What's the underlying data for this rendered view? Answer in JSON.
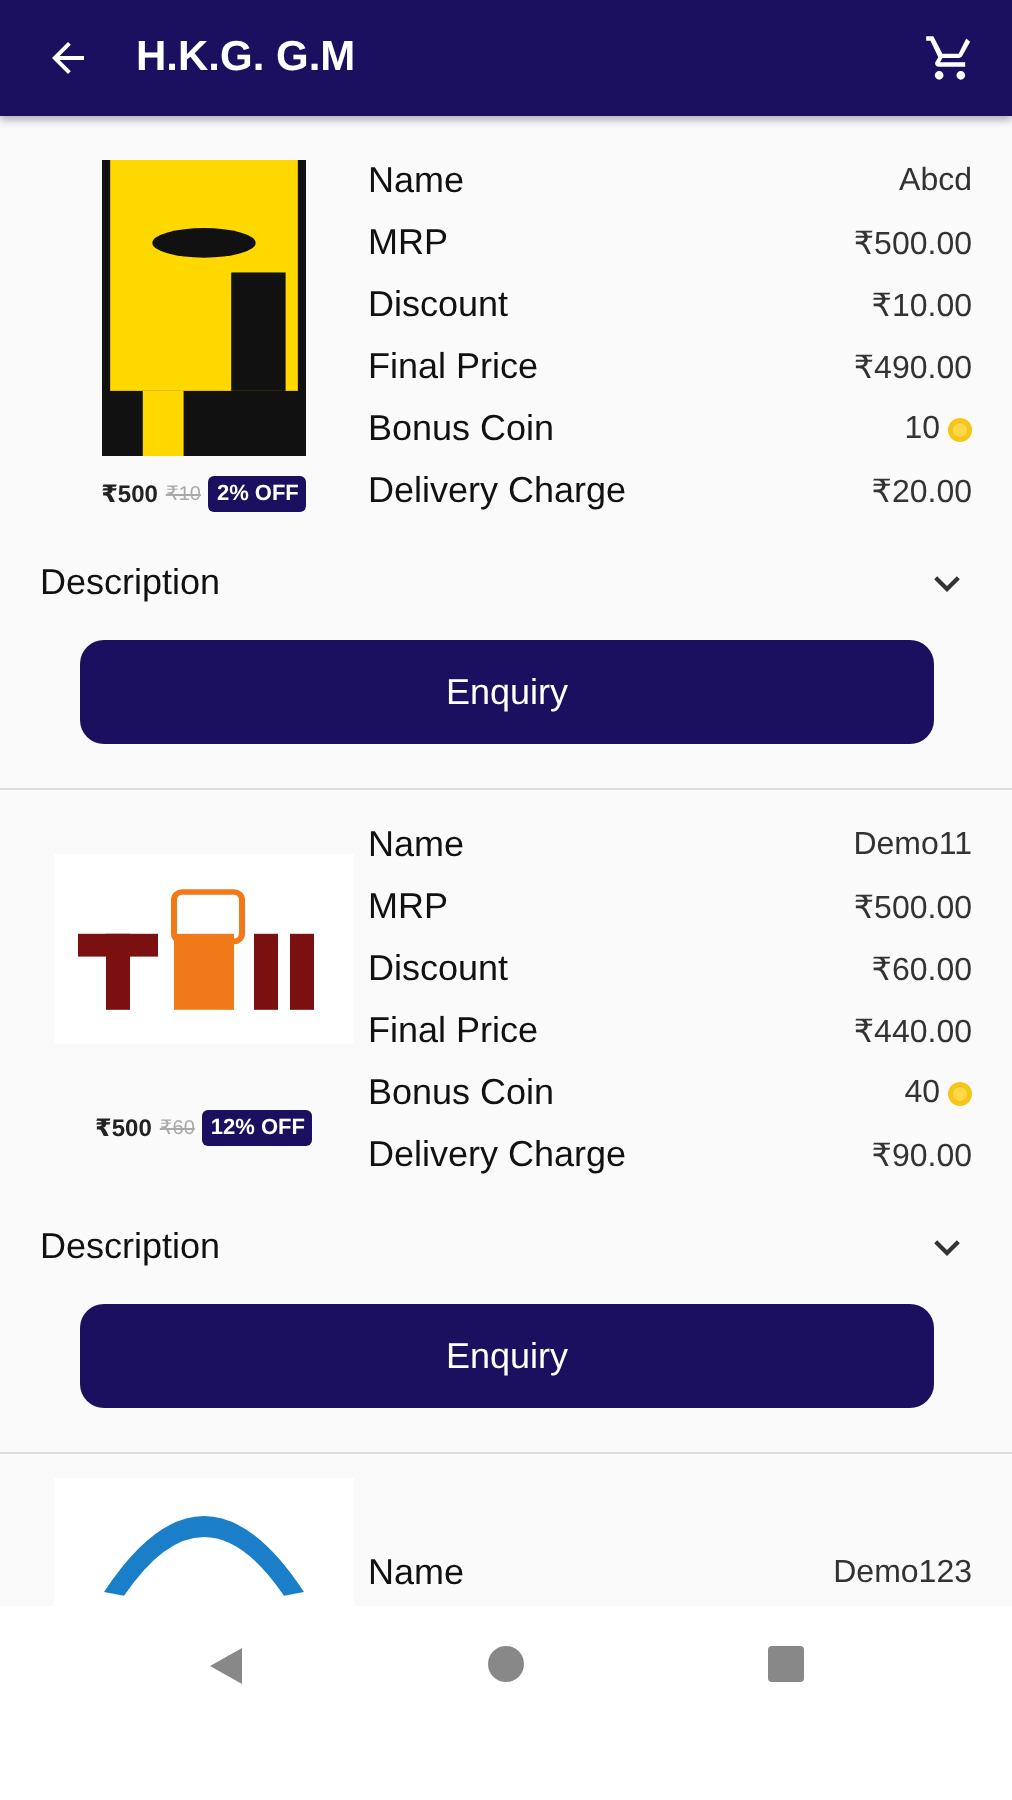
{
  "app_bar": {
    "title": "H.K.G. G.M"
  },
  "products": [
    {
      "price": "₹500",
      "old_price": "₹10",
      "discount_badge": "2% OFF",
      "fields": [
        {
          "label": "Name",
          "value": "Abcd",
          "kind": "text"
        },
        {
          "label": "MRP",
          "value": "₹500.00",
          "kind": "text"
        },
        {
          "label": "Discount",
          "value": "₹10.00",
          "kind": "text"
        },
        {
          "label": "Final Price",
          "value": "₹490.00",
          "kind": "text"
        },
        {
          "label": "Bonus Coin",
          "value": "10",
          "kind": "coin"
        },
        {
          "label": "Delivery Charge",
          "value": "₹20.00",
          "kind": "text"
        }
      ],
      "description": {
        "label": "Description",
        "expanded": false
      },
      "button": "Enquiry"
    },
    {
      "price": "₹500",
      "old_price": "₹60",
      "discount_badge": "12% OFF",
      "fields": [
        {
          "label": "Name",
          "value": "Demo11",
          "kind": "text"
        },
        {
          "label": "MRP",
          "value": "₹500.00",
          "kind": "text"
        },
        {
          "label": "Discount",
          "value": "₹60.00",
          "kind": "text"
        },
        {
          "label": "Final Price",
          "value": "₹440.00",
          "kind": "text"
        },
        {
          "label": "Bonus Coin",
          "value": "40",
          "kind": "coin"
        },
        {
          "label": "Delivery Charge",
          "value": "₹90.00",
          "kind": "text"
        }
      ],
      "description": {
        "label": "Description",
        "expanded": false
      },
      "button": "Enquiry"
    },
    {
      "fields": [
        {
          "label": "Name",
          "value": "Demo123",
          "kind": "text"
        }
      ]
    }
  ]
}
